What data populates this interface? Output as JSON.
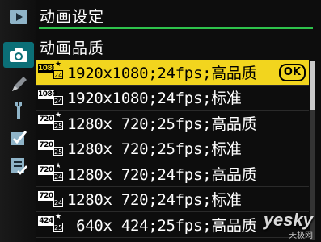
{
  "header": {
    "title": "动画设定"
  },
  "menu": {
    "subtitle": "动画品质"
  },
  "rows": [
    {
      "res": "1080",
      "fps": "24",
      "label": "1920x1080;24fps;高品质",
      "selected": true
    },
    {
      "res": "1080",
      "fps": "24",
      "label": "1920x1080;24fps;标准",
      "selected": false
    },
    {
      "res": "720",
      "fps": "25",
      "label": "1280x 720;25fps;高品质",
      "selected": false
    },
    {
      "res": "720",
      "fps": "25",
      "label": "1280x 720;25fps;标准",
      "selected": false
    },
    {
      "res": "720",
      "fps": "24",
      "label": "1280x 720;24fps;高品质",
      "selected": false
    },
    {
      "res": "720",
      "fps": "24",
      "label": "1280x 720;24fps;标准",
      "selected": false
    },
    {
      "res": "424",
      "fps": "25",
      "label": " 640x 424;25fps;高品质",
      "selected": false
    }
  ],
  "ok_label": "OK",
  "sidebar_icons": [
    "playback-icon",
    "camera-icon",
    "pencil-icon",
    "wrench-icon",
    "checkmark-icon",
    "my-menu-icon"
  ],
  "watermark": {
    "brand": "yesky",
    "sub": "天极网"
  },
  "colors": {
    "highlight": "#f2d51e",
    "accent_line": "#2ec24b",
    "sidebar_active": "#0b6f77"
  }
}
